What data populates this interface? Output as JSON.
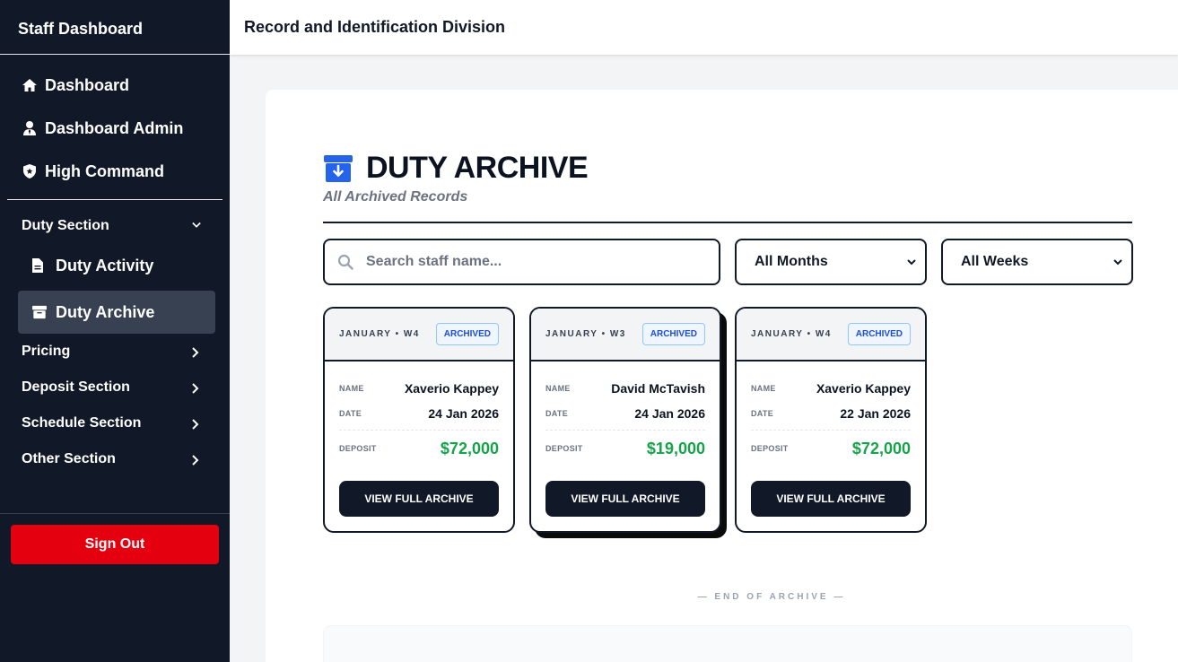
{
  "sidebar": {
    "brand": "Staff Dashboard",
    "top_items": [
      {
        "label": "Dashboard",
        "icon": "home-icon"
      },
      {
        "label": "Dashboard Admin",
        "icon": "user-tie-icon"
      },
      {
        "label": "High Command",
        "icon": "shield-icon"
      }
    ],
    "duty_section": {
      "label": "Duty Section",
      "items": [
        {
          "label": "Duty Activity",
          "icon": "file-icon"
        },
        {
          "label": "Duty Archive",
          "icon": "archive-icon",
          "active": true
        }
      ]
    },
    "sections": [
      {
        "label": "Pricing"
      },
      {
        "label": "Deposit Section"
      },
      {
        "label": "Schedule Section"
      },
      {
        "label": "Other Section"
      }
    ],
    "sign_out": "Sign Out"
  },
  "header": {
    "title": "Record and Identification Division"
  },
  "main": {
    "title": "DUTY ARCHIVE",
    "subtitle": "All Archived Records",
    "search": {
      "placeholder": "Search staff name...",
      "value": ""
    },
    "filters": {
      "month": "All Months",
      "week": "All Weeks"
    },
    "cards": [
      {
        "period": "JANUARY • W4",
        "status": "ARCHIVED",
        "name_label": "NAME",
        "name": "Xaverio Kappey",
        "date_label": "DATE",
        "date": "24 Jan 2026",
        "deposit_label": "DEPOSIT",
        "deposit": "$72,000",
        "button": "VIEW FULL ARCHIVE"
      },
      {
        "period": "JANUARY • W3",
        "status": "ARCHIVED",
        "name_label": "NAME",
        "name": "David McTavish",
        "date_label": "DATE",
        "date": "24 Jan 2026",
        "deposit_label": "DEPOSIT",
        "deposit": "$19,000",
        "button": "VIEW FULL ARCHIVE"
      },
      {
        "period": "JANUARY • W4",
        "status": "ARCHIVED",
        "name_label": "NAME",
        "name": "Xaverio Kappey",
        "date_label": "DATE",
        "date": "22 Jan 2026",
        "deposit_label": "DEPOSIT",
        "deposit": "$72,000",
        "button": "VIEW FULL ARCHIVE"
      }
    ],
    "end_text": "— END OF ARCHIVE —"
  },
  "colors": {
    "sidebar_bg": "#111827",
    "active_bg": "#374151",
    "accent_blue": "#2563eb",
    "money_green": "#16a34a",
    "sign_out_red": "#e5000f"
  }
}
